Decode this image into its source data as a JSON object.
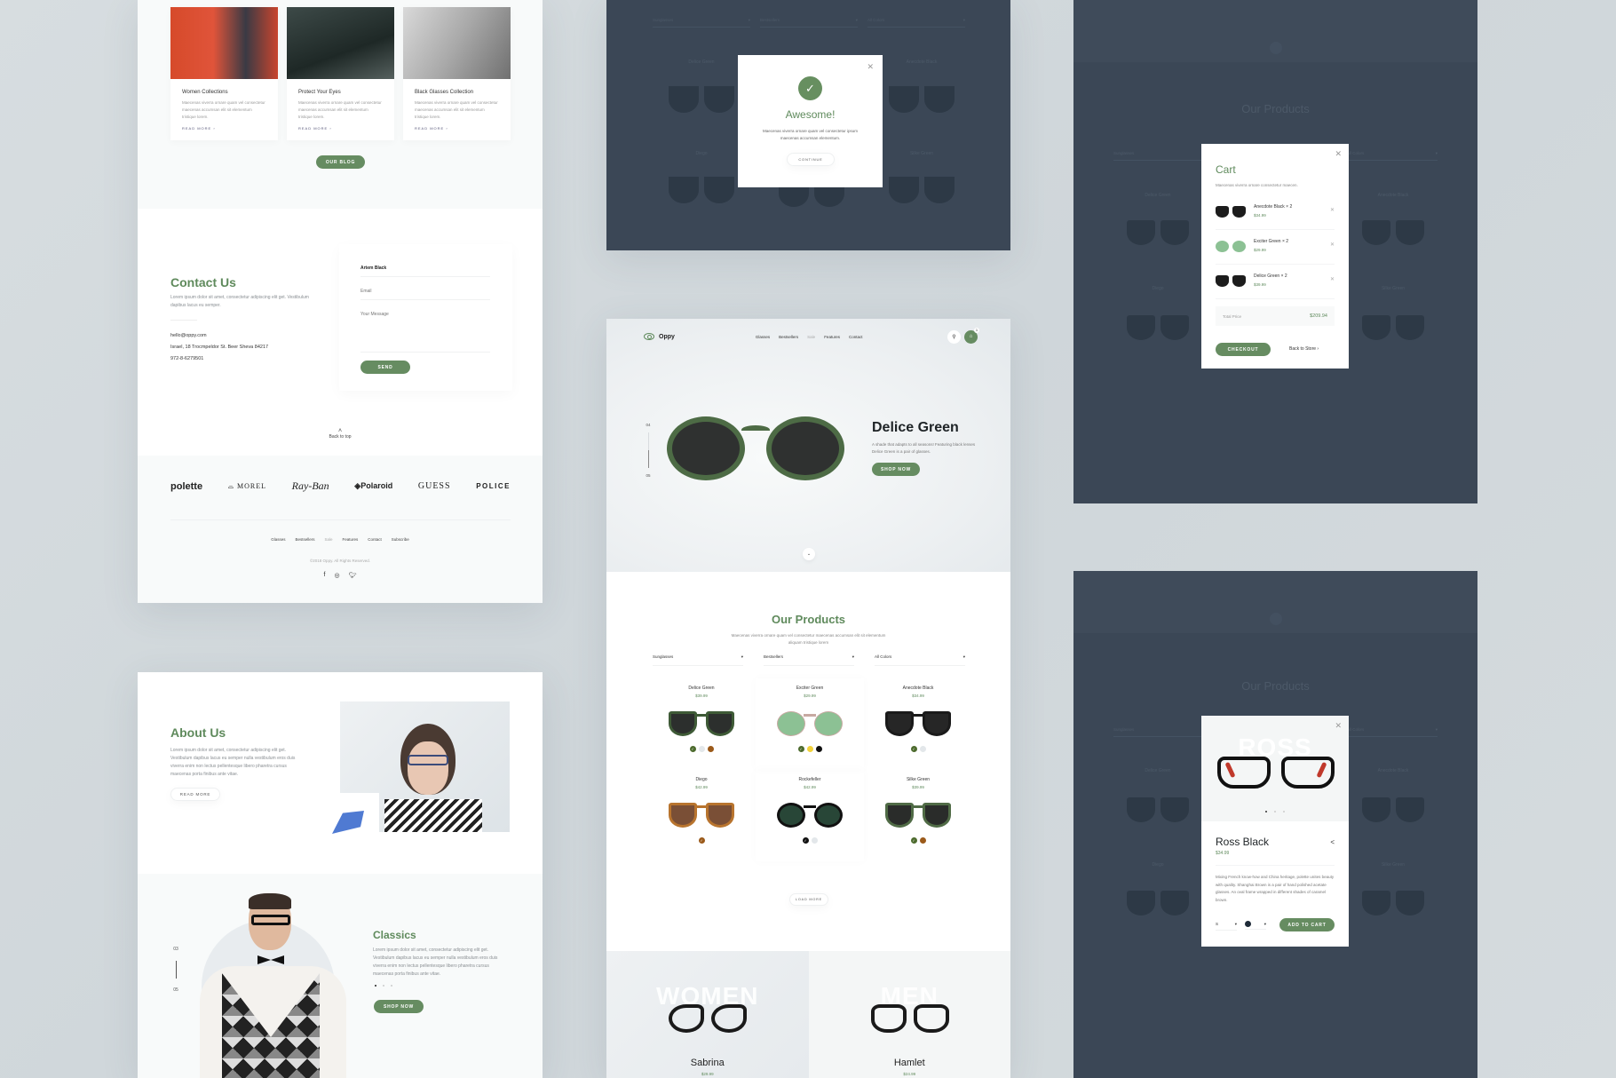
{
  "colors": {
    "accent_green": "#668c61",
    "title_green": "#5f8a5c",
    "overlay_dark": "#3b4756",
    "canvas_bg": "#d5dbde"
  },
  "blog": {
    "cards": [
      {
        "title": "Women Collections",
        "text": "Maecenas viverra ornare quam vel consectetur maecenas accumsan elit sit elementum tristique lorem.",
        "link": "READ MORE  ›"
      },
      {
        "title": "Protect Your Eyes",
        "text": "Maecenas viverra ornare quam vel consectetur maecenas accumsan elit sit elementum tristique lorem.",
        "link": "READ MORE  ›"
      },
      {
        "title": "Black Glasses Collection",
        "text": "Maecenas viverra ornare quam vel consectetur maecenas accumsan elit sit elementum tristique lorem.",
        "link": "READ MORE  ›"
      }
    ],
    "button": "OUR BLOG"
  },
  "contact": {
    "title": "Contact Us",
    "text": "Lorem ipsum dolor sit amet, consectetur adipiscing elit get. Vestibulum dapibus lacus eu semper.",
    "email": "hello@oppy.com",
    "address": "Israel, 18 Trocmpeldor St. Beer Sheva 84217",
    "phone": "972-8-6279501",
    "form": {
      "name_value": "Artem Black",
      "email_placeholder": "Email",
      "message_placeholder": "Your Message",
      "send": "SEND"
    },
    "back_to_top": "Back to top"
  },
  "brands": [
    "polette",
    "MOREL",
    "Ray-Ban",
    "Polaroid",
    "GUESS",
    "POLICE"
  ],
  "footer": {
    "nav": [
      "Glasses",
      "Bestsellers",
      "Sale",
      "Features",
      "Contact",
      "Subscribe"
    ],
    "copyright": "©2018 Oppy. All Rights Reserved.",
    "socials": [
      "facebook",
      "instagram",
      "twitter"
    ]
  },
  "about": {
    "title": "About Us",
    "text": "Lorem ipsum dolor sit amet, consectetur adipiscing elit get. Vestibulum dapibus lacus eu semper nulla vestibulum eros duis viverra enim non lectus pellentesque libero pharetra cursus maecenas porta finibus ante vitae.",
    "button": "READ MORE"
  },
  "classics": {
    "title": "Classics",
    "text": "Lorem ipsum dolor sit amet, consectetur adipiscing elit get. Vestibulum dapibus lacus eu semper nulla vestibulum eros duis viverra enim non lectus pellentesque libero pharetra cursus maecenas porta finibus ante vitae.",
    "pager_current": "03",
    "pager_total": "05",
    "button": "SHOP NOW"
  },
  "success_modal": {
    "title": "Awesome!",
    "text": "Maecenas viverra ornare quam vel consectetur ipsum maecenas accumsan elementum.",
    "button": "CONTINUE",
    "background_filters": [
      "Sunglasses",
      "Bestsellers",
      "All Colors"
    ],
    "background_products": [
      "Delice Green",
      "Anecdote Black",
      "Diego",
      "Silke Green"
    ]
  },
  "landing": {
    "nav": {
      "logo": "Oppy",
      "links": [
        "Glasses",
        "Bestsellers",
        "Sale",
        "Features",
        "Contact"
      ],
      "cart_count": "1"
    },
    "hero": {
      "title": "Delice Green",
      "text": "A shade that adapts to all seasons! Featuring black lenses Delice Green is a pair of glasses.",
      "button": "SHOP NOW",
      "pager_current": "04",
      "pager_total": "05"
    },
    "products": {
      "title": "Our Products",
      "subtitle": "Maecenas viverra ornare quam vel consectetur maecenas accumsan elit sit elementum aliquam tristique lorem",
      "filters": [
        "Sunglasses",
        "Bestsellers",
        "All Colors"
      ],
      "items": [
        {
          "name": "Delice Green",
          "price": "$39.99",
          "lens": "#2c2f2d",
          "frame": "#3e5a36",
          "swatches": [
            "#4d6b2e",
            "#e3e7ea",
            "#9b5a1a"
          ],
          "selected": 0
        },
        {
          "name": "Exciter Green",
          "price": "$29.99",
          "lens": "#8cc194",
          "frame": "#c8a9a2",
          "swatches": [
            "#4d6b2e",
            "#f2d23c",
            "#111111"
          ],
          "selected": 0
        },
        {
          "name": "Anecdote Black",
          "price": "$34.99",
          "lens": "#262626",
          "frame": "#1a1a1a",
          "swatches": [
            "#4d6b2e",
            "#e3e7ea"
          ],
          "selected": 0
        },
        {
          "name": "Diego",
          "price": "$42.99",
          "lens": "#7a4f36",
          "frame": "#b8742e",
          "swatches": [
            "#9b5a1a"
          ],
          "selected": 0
        },
        {
          "name": "Rockefeller",
          "price": "$42.99",
          "lens": "#284637",
          "frame": "#111111",
          "swatches": [
            "#111111",
            "#e3e7ea"
          ],
          "selected": 0
        },
        {
          "name": "Silke Green",
          "price": "$39.99",
          "lens": "#2a2c2a",
          "frame": "#506b46",
          "swatches": [
            "#4d6b2e",
            "#9b5a1a"
          ],
          "selected": 0
        }
      ],
      "load_more": "LOAD MORE"
    },
    "categories": [
      {
        "label": "WOMEN",
        "name": "Sabrina",
        "price": "$29.99"
      },
      {
        "label": "MEN",
        "name": "Hamlet",
        "price": "$24.99"
      }
    ]
  },
  "cart_modal": {
    "title": "Cart",
    "subtitle": "Maecenas viverra ornare consectetur maecen.",
    "items": [
      {
        "name": "Anecdote Black × 2",
        "price": "$34.99",
        "lens": "#1c1c1c",
        "round": false
      },
      {
        "name": "Exciter Green × 2",
        "price": "$29.99",
        "lens": "#8cc194",
        "round": true
      },
      {
        "name": "Delice Green × 2",
        "price": "$39.99",
        "lens": "#1c1c1c",
        "round": false
      }
    ],
    "total_label": "Total Price",
    "total_value": "$209.94",
    "checkout": "CHECKOUT",
    "back": "Back to Store  ›",
    "background_title": "Our Products",
    "background_filters": [
      "Sunglasses",
      "Bestsellers",
      "All Colors"
    ],
    "background_products": [
      "Delice Green",
      "Anecdote Black",
      "Diego",
      "Silke Green"
    ]
  },
  "quickview_modal": {
    "big_label": "ROSS",
    "name": "Ross Black",
    "price": "$34.99",
    "description": "Mixing French know-how and China heritage, polette unites beauty with quality. Shanghai Brown is a pair of hand polished acetate glasses. An oval frame wrapped in different shades of caramel brown.",
    "size": "S",
    "add_to_cart": "ADD TO CART",
    "slide_count": 3,
    "slide_current": 1,
    "background_title": "Our Products",
    "background_filters": [
      "Sunglasses",
      "Bestsellers",
      "All Colors"
    ],
    "background_products": [
      "Delice Green",
      "Anecdote Black",
      "Diego",
      "Silke Green"
    ]
  }
}
